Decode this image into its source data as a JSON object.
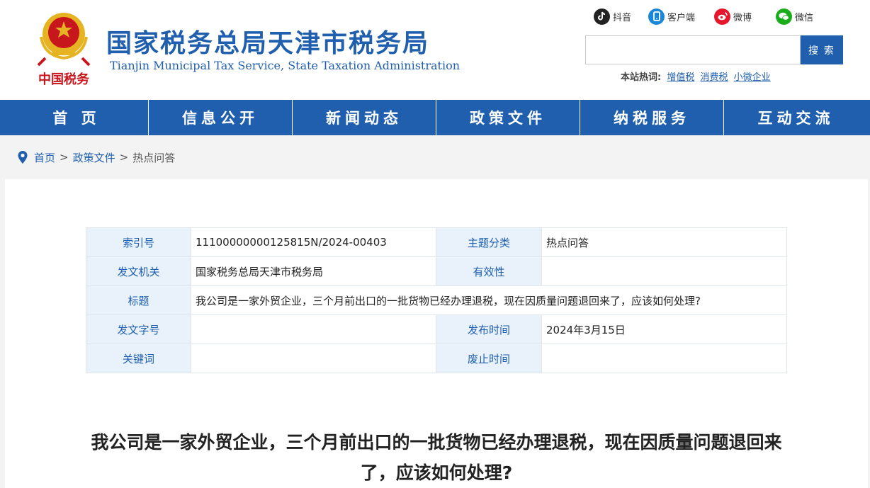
{
  "header": {
    "title": "国家税务总局天津市税务局",
    "subtitle": "Tianjin Municipal Tax Service, State Taxation Administration",
    "logo_text": "中国税务"
  },
  "social": {
    "douyin": "抖音",
    "client": "客户端",
    "weibo": "微博",
    "wechat": "微信"
  },
  "search": {
    "placeholder": "",
    "button": "搜 索"
  },
  "hot": {
    "label": "本站热词:",
    "terms": [
      "增值税",
      "消费税",
      "小微企业"
    ]
  },
  "nav": [
    "首 页",
    "信息公开",
    "新闻动态",
    "政策文件",
    "纳税服务",
    "互动交流"
  ],
  "breadcrumb": {
    "home": "首页",
    "sep": ">",
    "policy": "政策文件",
    "current": "热点问答"
  },
  "meta": {
    "index_label": "索引号",
    "index_value": "11100000000125815N/2024-00403",
    "topic_label": "主题分类",
    "topic_value": "热点问答",
    "issuer_label": "发文机关",
    "issuer_value": "国家税务总局天津市税务局",
    "validity_label": "有效性",
    "validity_value": "",
    "title_label": "标题",
    "title_value": "我公司是一家外贸企业，三个月前出口的一批货物已经办理退税，现在因质量问题退回来了，应该如何处理?",
    "docno_label": "发文字号",
    "docno_value": "",
    "pubdate_label": "发布时间",
    "pubdate_value": "2024年3月15日",
    "keyword_label": "关键词",
    "keyword_value": "",
    "expiry_label": "废止时间",
    "expiry_value": ""
  },
  "article": {
    "title": "我公司是一家外贸企业，三个月前出口的一批货物已经办理退税，现在因质量问题退回来了，应该如何处理?"
  },
  "colors": {
    "brand": "#1f5fae",
    "emblem_red": "#c8161d",
    "emblem_gold": "#e6b422"
  }
}
